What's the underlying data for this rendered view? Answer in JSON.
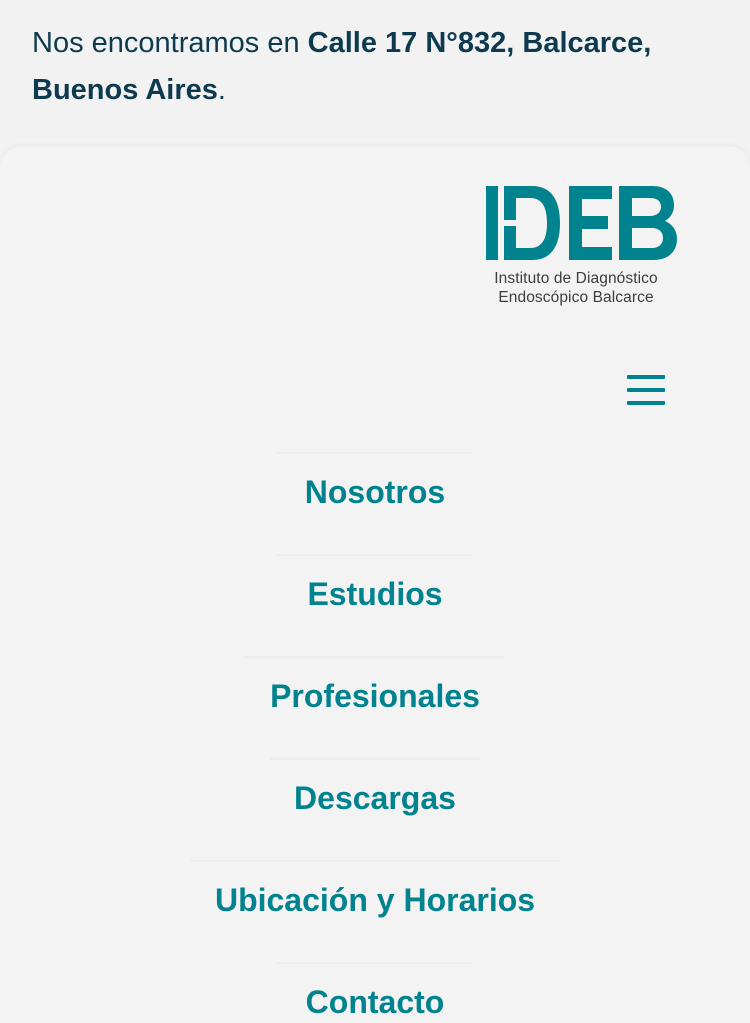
{
  "header": {
    "address_prefix": "Nos encontramos en ",
    "address_bold": "Calle 17 N°832, Balcarce, Buenos Aires",
    "address_suffix": "."
  },
  "logo": {
    "wordmark": "IDEB",
    "tagline_line1": "Instituto de Diagnóstico",
    "tagline_line2": "Endoscópico Balcarce",
    "color": "#00838f"
  },
  "menu": {
    "toggle_icon": "hamburger-menu-icon",
    "items": [
      {
        "label": "Nosotros"
      },
      {
        "label": "Estudios"
      },
      {
        "label": "Profesionales"
      },
      {
        "label": "Descargas"
      },
      {
        "label": "Ubicación y Horarios"
      },
      {
        "label": "Contacto"
      }
    ]
  },
  "colors": {
    "accent": "#00838f",
    "text_dark": "#0d3a4e",
    "background": "#f2f2f2"
  }
}
